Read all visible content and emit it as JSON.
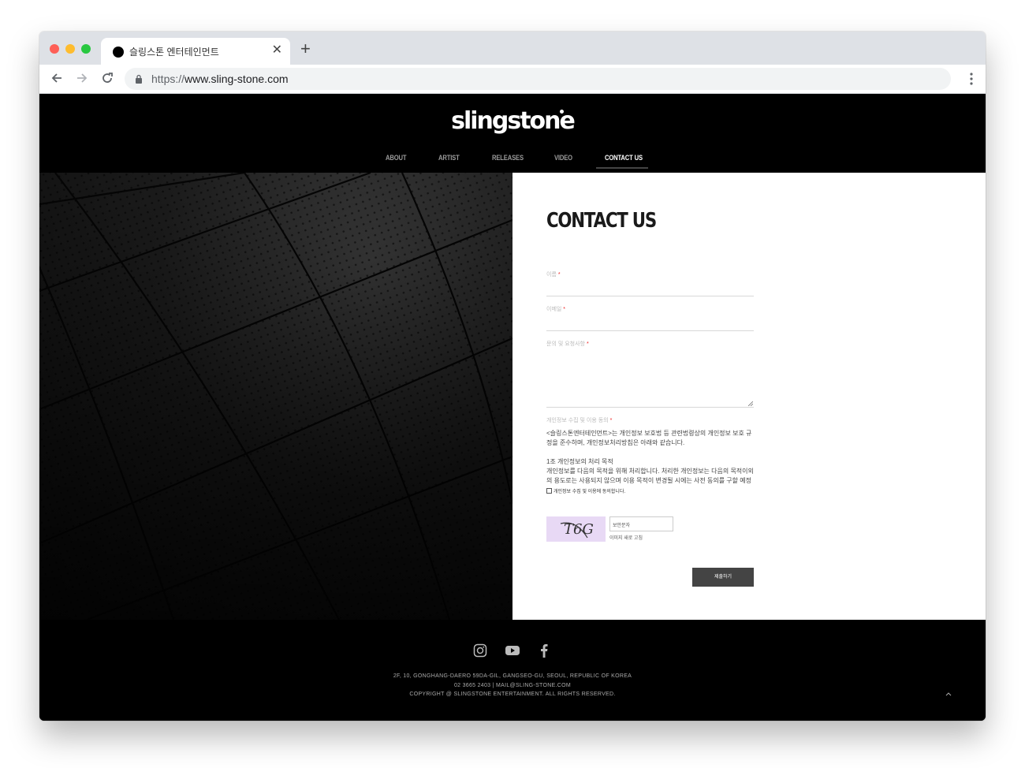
{
  "browser": {
    "tab_title": "슬링스톤 엔터테인먼트",
    "url_protocol": "https://",
    "url_host": "www.sling-stone.com",
    "tab_close": "✕",
    "new_tab": "+"
  },
  "site": {
    "logo": "slingstone",
    "nav": [
      {
        "label": "ABOUT",
        "active": false
      },
      {
        "label": "ARTIST",
        "active": false
      },
      {
        "label": "RELEASES",
        "active": false
      },
      {
        "label": "VIDEO",
        "active": false
      },
      {
        "label": "CONTACT US",
        "active": true
      }
    ]
  },
  "form": {
    "title": "CONTACT US",
    "name_label": "이름",
    "email_label": "이메일",
    "message_label": "문의 및 요청사항",
    "required_mark": "*",
    "privacy_label": "개인정보 수집 및 이용 동의",
    "privacy_text_1": "<슬링스톤엔터테인먼트>는 개인정보 보호법 등 관련법령상의 개인정보 보호 규정을 준수하며, 개인정보처리방침은 아래와 같습니다.",
    "privacy_text_2": "1조 개인정보의 처리 목적",
    "privacy_text_3": "개인정보를 다음의 목적을 위해 처리합니다.  처리한 개인정보는 다음의 목적이외의 용도로는 사용되지 않으며 이용 목적이 변경될 시에는 사전 동의를 구할 예정입니다.",
    "agree_label": "개인정보 수집 및 이용에 동의합니다.",
    "captcha_text": "T6G",
    "captcha_placeholder": "보안문자",
    "captcha_refresh": "이미지 새로 고침",
    "submit_label": "제출하기"
  },
  "footer": {
    "address": "2F, 10, GONGHANG-DAERO 59DA-GIL, GANGSEO-GU, SEOUL, REPUBLIC OF KOREA",
    "contact": "02 3665 2403  |  MAIL@SLING-STONE.COM",
    "copyright": "COPYRIGHT @ SLINGSTONE ENTERTAINMENT. ALL RIGHTS RESERVED."
  },
  "colors": {
    "accent_required": "#ee2222",
    "header_bg": "#000000",
    "submit_bg": "#444444",
    "captcha_bg": "#e8d9f5"
  },
  "icons": [
    "back-arrow-icon",
    "forward-arrow-icon",
    "reload-icon",
    "lock-icon",
    "more-vert-icon",
    "instagram-icon",
    "youtube-icon",
    "facebook-icon",
    "chevron-up-icon"
  ]
}
